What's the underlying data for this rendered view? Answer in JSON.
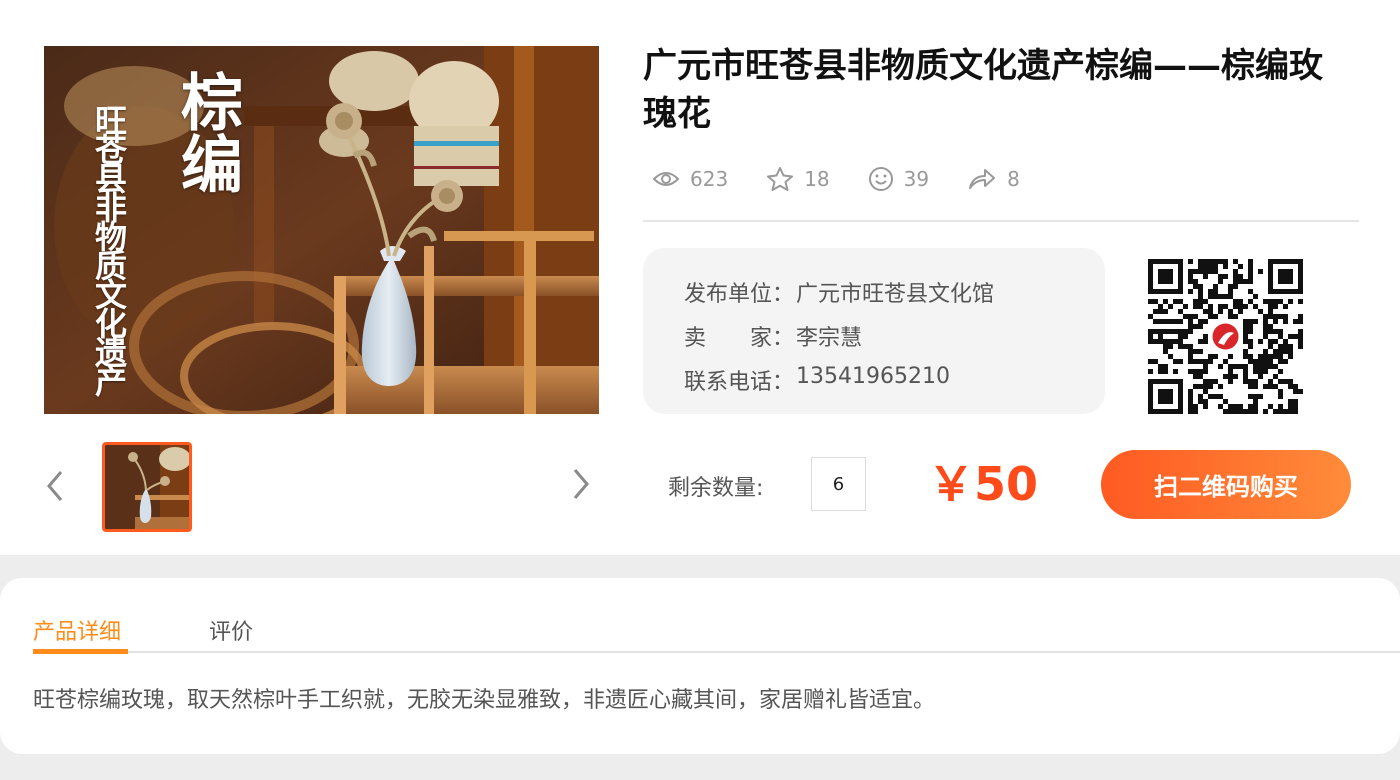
{
  "product": {
    "title": "广元市旺苍县非物质文化遗产棕编——棕编玫瑰花",
    "image_text_vertical": "旺苍县非物质文化遗产",
    "image_text_big": "棕编"
  },
  "stats": {
    "views": "623",
    "favorites": "18",
    "likes": "39",
    "shares": "8"
  },
  "info": {
    "publisher_label": "发布单位：",
    "publisher": "广元市旺苍县文化馆",
    "seller_label": "卖　　家：",
    "seller": "李宗慧",
    "phone_label": "联系电话：",
    "phone": "13541965210"
  },
  "purchase": {
    "quantity_label": "剩余数量:",
    "quantity": "6",
    "price": "￥50",
    "buy_label": "扫二维码购买"
  },
  "tabs": [
    {
      "label": "产品详细",
      "active": true
    },
    {
      "label": "评价",
      "active": false
    }
  ],
  "description": "旺苍棕编玫瑰，取天然棕叶手工织就，无胶无染显雅致，非遗匠心藏其间，家居赠礼皆适宜。",
  "colors": {
    "accent": "#ff4a1a",
    "tab_active": "#ff8c1a",
    "button_start": "#ff5a22",
    "button_end": "#ff8c3a"
  },
  "icons": [
    "eye-icon",
    "star-icon",
    "smile-icon",
    "share-icon",
    "chevron-left-icon",
    "chevron-right-icon",
    "qr-code-icon"
  ]
}
